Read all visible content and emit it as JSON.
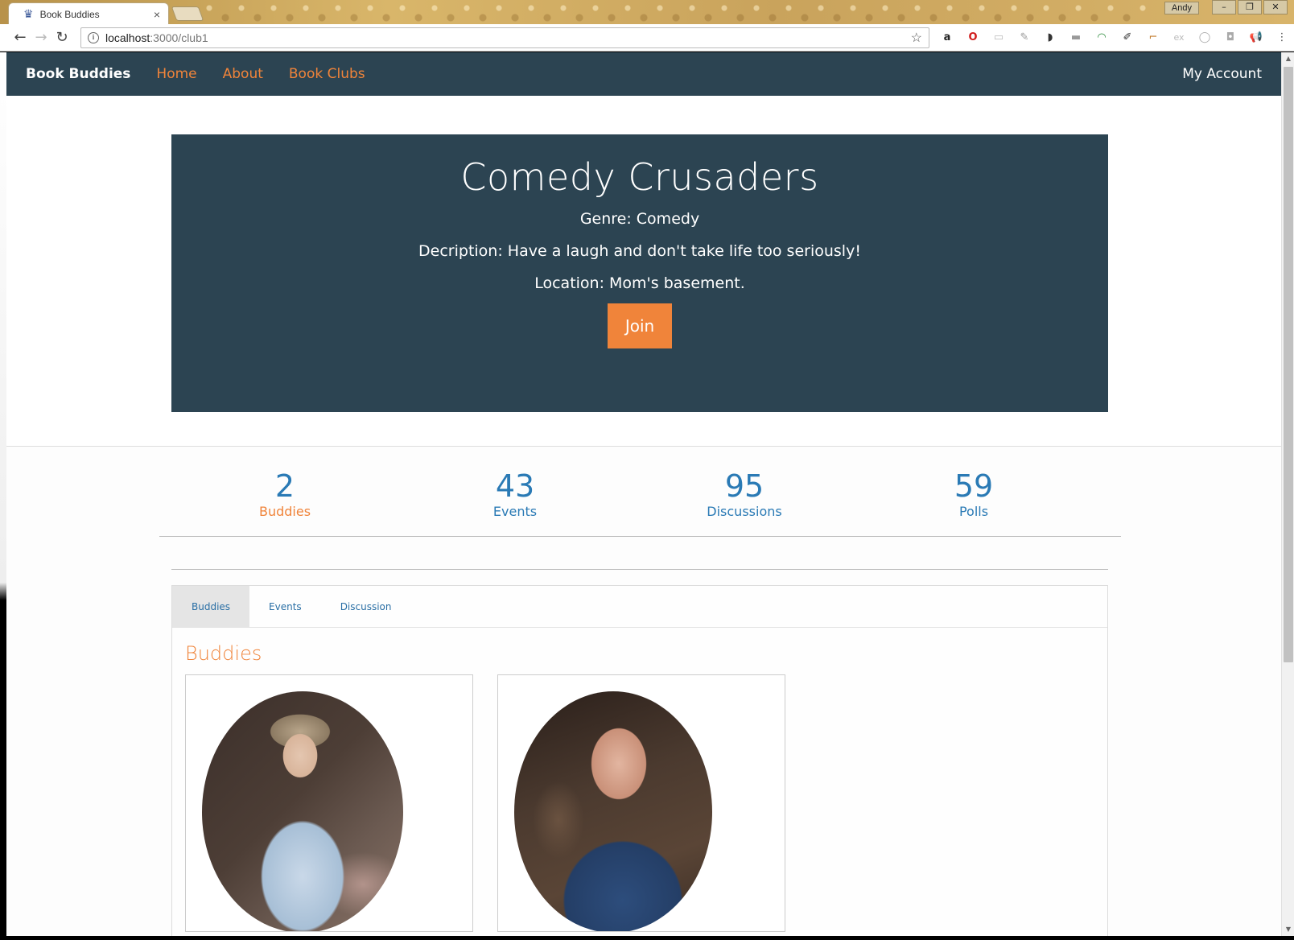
{
  "browser": {
    "tab_title": "Book Buddies",
    "tab_close": "×",
    "user": "Andy",
    "window_buttons": [
      "–",
      "❐",
      "✕"
    ],
    "url_host": "localhost",
    "url_path": ":3000/club1",
    "nav": {
      "back": "←",
      "forward": "→",
      "reload": "↻"
    },
    "star": "☆",
    "extensions": [
      "a",
      "O",
      "▭",
      "✎",
      "◗",
      "▬",
      "◠",
      "✐",
      "⌐",
      "ex",
      "◯",
      "◘",
      "📢",
      "⋮"
    ]
  },
  "site_nav": {
    "brand": "Book Buddies",
    "links": [
      "Home",
      "About",
      "Book Clubs"
    ],
    "account": "My Account"
  },
  "club": {
    "name": "Comedy Crusaders",
    "genre": "Genre: Comedy",
    "description": "Decription: Have a laugh and don't take life too seriously!",
    "location": "Location: Mom's basement.",
    "join_label": "Join"
  },
  "stats": [
    {
      "value": "2",
      "label": "Buddies"
    },
    {
      "value": "43",
      "label": "Events"
    },
    {
      "value": "95",
      "label": "Discussions"
    },
    {
      "value": "59",
      "label": "Polls"
    }
  ],
  "colors": {
    "navy": "#2c4452",
    "accent_orange": "#f0843a",
    "link_blue": "#2a7ab5"
  },
  "tabs": [
    "Buddies",
    "Events",
    "Discussion"
  ],
  "active_tab": "Buddies",
  "section_title": "Buddies"
}
